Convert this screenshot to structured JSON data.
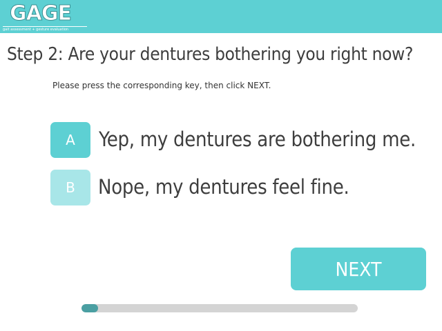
{
  "header": {
    "logo_text": "GAGE",
    "logo_tagline": "gait assessment + gesture evaluation"
  },
  "question": {
    "title": "Step 2: Are your dentures bothering you right now?",
    "instructions": "Please press the corresponding key, then click NEXT."
  },
  "options": [
    {
      "key": "A",
      "label": "Yep, my dentures are bothering me."
    },
    {
      "key": "B",
      "label": "Nope, my dentures feel fine."
    }
  ],
  "next_label": "NEXT",
  "progress": {
    "fraction": 0.06
  },
  "colors": {
    "brand": "#5dd0d3",
    "option_b_badge": "#a8e6e8",
    "progress_fill": "#4a9fa2",
    "progress_track": "#d4d4d4"
  }
}
